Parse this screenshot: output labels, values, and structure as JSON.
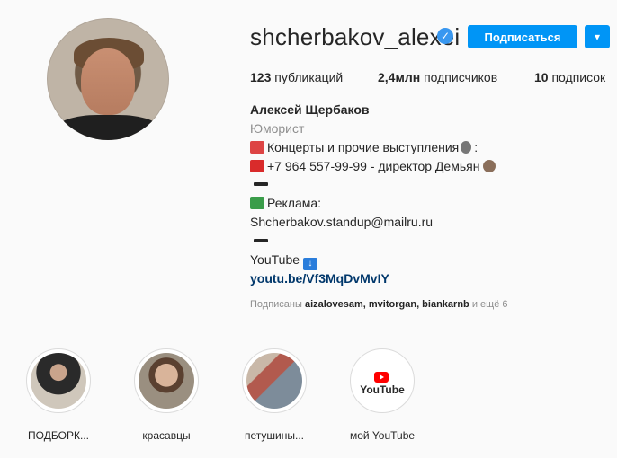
{
  "profile": {
    "username": "shcherbakov_alexei",
    "follow_label": "Подписаться",
    "dropdown_icon": "chevron-down-icon",
    "verified_icon": "verified-badge-icon"
  },
  "stats": {
    "posts_count": "123",
    "posts_label": "публикаций",
    "followers_count": "2,4млн",
    "followers_label": "подписчиков",
    "following_count": "10",
    "following_label": "подписок"
  },
  "bio": {
    "name": "Алексей Щербаков",
    "category": "Юморист",
    "line1": "Концерты и прочие выступления",
    "line1_end": ":",
    "line2": "+7 964 557-99-99 - директор Демьян",
    "ads_label": "Реклама:",
    "email": "Shcherbakov.standup@mailru.ru",
    "youtube_label": "YouTube",
    "youtube_link": "youtu.be/Vf3MqDvMvIY"
  },
  "followed_by": {
    "prefix": "Подписаны",
    "users": "aizalovesam, mvitorgan, biankarnb",
    "suffix": "и ещё 6"
  },
  "highlights": [
    {
      "label": "ПОДБОРК..."
    },
    {
      "label": "красавцы"
    },
    {
      "label": "петушины..."
    },
    {
      "label": "мой YouTube"
    }
  ],
  "youtube_logo_text": "YouTube"
}
